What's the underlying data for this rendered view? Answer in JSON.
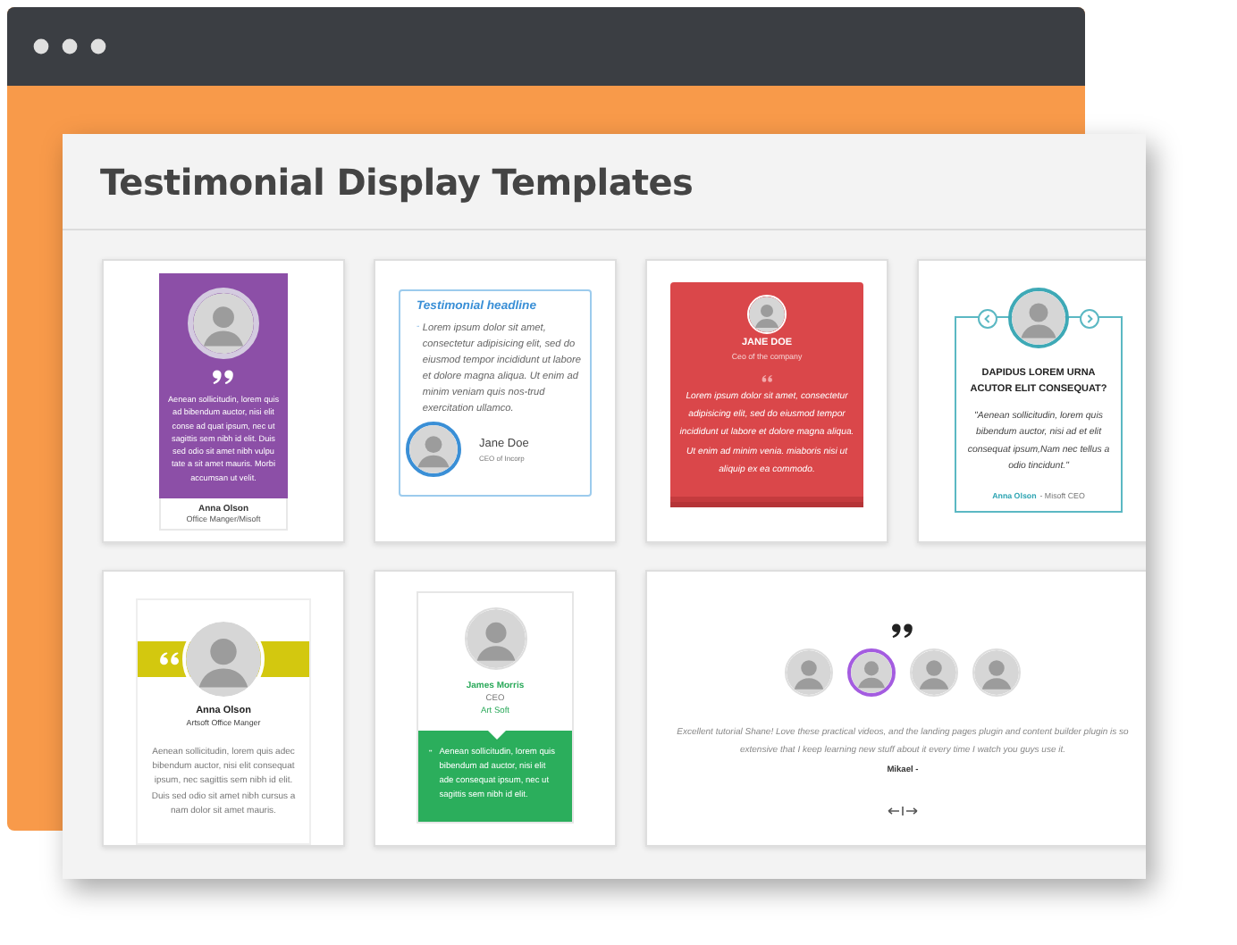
{
  "panel": {
    "title": "Testimonial Display Templates"
  },
  "templates": [
    {
      "kind": "purple-portrait",
      "text": "Aenean sollicitudin, lorem quis ad bibendum auctor, nisi elit conse ad quat ipsum, nec ut sagittis sem nibh id elit. Duis sed odio sit amet nibh vulpu tate a sit amet mauris. Morbi accumsan ut velit.",
      "name": "Anna Olson",
      "role": "Office Manger/Misoft"
    },
    {
      "kind": "headline-box",
      "headline": "Testimonial headline",
      "text": "Lorem ipsum dolor sit amet, consectetur adipisicing elit, sed do eiusmod tempor incididunt ut labore et dolore magna aliqua. Ut enim ad minim veniam quis nos-trud exercitation ullamco.",
      "name": "Jane Doe",
      "role": "CEO of Incorp"
    },
    {
      "kind": "red-stack",
      "name": "JANE DOE",
      "role": "Ceo of the company",
      "text": "Lorem ipsum dolor sit amet, consectetur adipisicing elit, sed do eiusmod tempor incididunt ut labore et dolore magna aliqua. Ut enim ad minim venia. miaboris nisi ut aliquip ex ea commodo."
    },
    {
      "kind": "teal-frame",
      "headline": "DAPIDUS LOREM URNA ACUTOR ELIT CONSEQUAT?",
      "text": "\"Aenean sollicitudin, lorem quis bibendum auctor, nisi ad et elit consequat ipsum,Nam nec tellus a odio tincidunt.\"",
      "name": "Anna Olson",
      "role": "- Misoft CEO"
    },
    {
      "kind": "yellow-band",
      "name": "Anna Olson",
      "role": "Artsoft Office Manger",
      "text": "Aenean sollicitudin, lorem quis adec bibendum auctor, nisi elit consequat ipsum, nec sagittis sem nibh id elit. Duis sed odio sit amet nibh cursus a nam dolor sit amet mauris."
    },
    {
      "kind": "green-bubble",
      "name": "James Morris",
      "role": "CEO",
      "company": "Art Soft",
      "text": "Aenean sollicitudin, lorem quis bibendum ad auctor, nisi elit ade consequat ipsum, nec ut sagittis sem nibh id elit."
    },
    {
      "kind": "avatar-carousel",
      "avatars": [
        {
          "selected": false
        },
        {
          "selected": true
        },
        {
          "selected": false
        },
        {
          "selected": false
        }
      ],
      "text": "Excellent tutorial Shane! Love these practical videos, and the landing pages plugin and content builder plugin is so extensive that I keep learning new stuff about it every time I watch you guys use it.",
      "name": "Mikael -"
    }
  ]
}
